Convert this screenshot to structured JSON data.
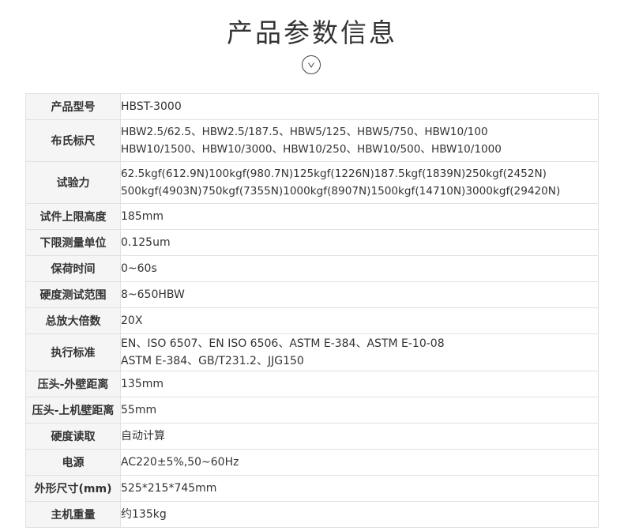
{
  "header": {
    "title": "产品参数信息",
    "down_icon": "chevron-down-icon"
  },
  "specs": {
    "model": {
      "label": "产品型号",
      "value": "HBST-3000"
    },
    "brinell_scale": {
      "label": "布氏标尺",
      "lines": [
        "HBW2.5/62.5、HBW2.5/187.5、HBW5/125、HBW5/750、HBW10/100",
        "HBW10/1500、HBW10/3000、HBW10/250、HBW10/500、HBW10/1000"
      ]
    },
    "test_force": {
      "label": "试验力",
      "lines": [
        "62.5kgf(612.9N)100kgf(980.7N)125kgf(1226N)187.5kgf(1839N)250kgf(2452N)",
        "500kgf(4903N)750kgf(7355N)1000kgf(8907N)1500kgf(14710N)3000kgf(29420N)"
      ]
    },
    "max_height": {
      "label": "试件上限高度",
      "value": "185mm"
    },
    "min_unit": {
      "label": "下限测量单位",
      "value": "0.125um"
    },
    "dwell_time": {
      "label": "保荷时间",
      "value": "0~60s"
    },
    "hardness_range": {
      "label": "硬度测试范围",
      "value": "8~650HBW"
    },
    "magnification": {
      "label": "总放大倍数",
      "value": "20X"
    },
    "standards": {
      "label": "执行标准",
      "lines": [
        "EN、ISO 6507、EN ISO 6506、ASTM E-384、ASTM E-10-08",
        "ASTM E-384、GB/T231.2、JJG150"
      ]
    },
    "indenter_outer": {
      "label": "压头-外壁距离",
      "value": "135mm"
    },
    "indenter_upper": {
      "label": "压头-上机壁距离",
      "value": "55mm"
    },
    "hardness_reading": {
      "label": "硬度读取",
      "value": "自动计算"
    },
    "power": {
      "label": "电源",
      "value": "AC220±5%,50~60Hz"
    },
    "dimensions": {
      "label": "外形尺寸(mm)",
      "value": "525*215*745mm"
    },
    "weight": {
      "label": "主机重量",
      "value": "约135kg"
    }
  }
}
